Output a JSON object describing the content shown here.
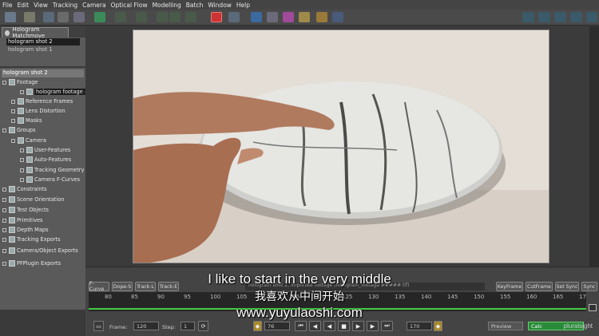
{
  "menu": [
    "File",
    "Edit",
    "View",
    "Tracking",
    "Camera",
    "Optical Flow",
    "Modelling",
    "Batch",
    "Window",
    "Help"
  ],
  "left_panel": {
    "tab_label": "Hologram Matchmove",
    "shots": [
      "hologram shot 2",
      "hologram shot 1"
    ],
    "tree_header": "hologram shot 2",
    "tree": [
      {
        "label": "Footage",
        "indent": 0
      },
      {
        "label": "hologram footage ##### tif",
        "indent": 2
      },
      {
        "label": "Reference Frames",
        "indent": 1
      },
      {
        "label": "Lens Distortion",
        "indent": 1
      },
      {
        "label": "Masks",
        "indent": 1
      },
      {
        "label": "Groups",
        "indent": 0
      },
      {
        "label": "Camera",
        "indent": 1
      },
      {
        "label": "User-Features",
        "indent": 2
      },
      {
        "label": "Auto-Features",
        "indent": 2
      },
      {
        "label": "Tracking Geometry",
        "indent": 2
      },
      {
        "label": "Camera F-Curves",
        "indent": 2
      },
      {
        "label": "Constraints",
        "indent": 0
      },
      {
        "label": "Scene Orientation",
        "indent": 0
      },
      {
        "label": "Test Objects",
        "indent": 0
      },
      {
        "label": "Primitives",
        "indent": 0
      },
      {
        "label": "Depth Maps",
        "indent": 0
      },
      {
        "label": "Tracking Exports",
        "indent": 0
      },
      {
        "label": "Camera/Object Exports",
        "indent": 0
      },
      {
        "label": "PFPlugin Exports",
        "indent": 0
      }
    ]
  },
  "timeline": {
    "tabs": [
      "F-Curve",
      "Dope-S",
      "Track-L",
      "Track-E"
    ],
    "info_text": "hologram shot 2, imported footage (hologram_footage ##### tif)",
    "right_buttons": [
      "KeyFrame",
      "CutFrame",
      "Set Sync",
      "Sync"
    ],
    "ticks": [
      "80",
      "85",
      "90",
      "95",
      "100",
      "105",
      "110",
      "115",
      "120",
      "125",
      "130",
      "135",
      "140",
      "145",
      "150",
      "155",
      "160",
      "165",
      "17"
    ]
  },
  "controls": {
    "frame_label": "Frame:",
    "frame_value": "120",
    "step_label": "Step:",
    "step_value": "1",
    "start_value": "76",
    "end_value": "170",
    "preview_label": "Preview",
    "track_label": "Calc"
  },
  "subtitles": {
    "english": "I like to start in the very middle",
    "chinese": "我喜欢从中间开始",
    "url": "www.yuyulaoshi.com"
  },
  "watermark": "pluralsight",
  "colors": {
    "menu_bg": "#444444",
    "panel_bg": "#5a5a5a",
    "accent_green": "#44cc44",
    "record_red": "#cc3333"
  }
}
